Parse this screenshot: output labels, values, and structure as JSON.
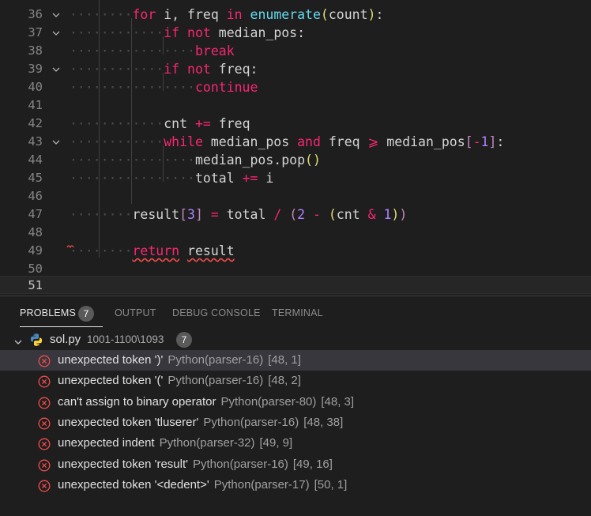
{
  "colors": {
    "editor_bg": "#1e1e1e",
    "keyword": "#f92672",
    "function": "#66d9ef",
    "number": "#ae81ff",
    "error": "#f14c4c",
    "badge_bg": "#5a5a5a",
    "selected_row": "#37373d"
  },
  "editor": {
    "lines": [
      {
        "n": "36"
      },
      {
        "n": "37"
      },
      {
        "n": "38"
      },
      {
        "n": "39"
      },
      {
        "n": "40"
      },
      {
        "n": "41"
      },
      {
        "n": "42"
      },
      {
        "n": "43"
      },
      {
        "n": "44"
      },
      {
        "n": "45"
      },
      {
        "n": "46"
      },
      {
        "n": "47"
      },
      {
        "n": "48"
      },
      {
        "n": "49"
      },
      {
        "n": "50"
      },
      {
        "n": "51"
      }
    ],
    "code": {
      "l36": {
        "indent": "········",
        "for": "for",
        "var": " i, freq ",
        "in": "in",
        "sp": " ",
        "fn": "enumerate",
        "p1": "(",
        "arg": "count",
        "p2": ")",
        "tail": ":"
      },
      "l37": {
        "indent": "············",
        "if": "if",
        "sp": " ",
        "not": "not",
        "rest": " median_pos:"
      },
      "l38": {
        "indent": "················",
        "kw": "break"
      },
      "l39": {
        "indent": "············",
        "if": "if",
        "sp": " ",
        "not": "not",
        "rest": " freq:"
      },
      "l40": {
        "indent": "················",
        "kw": "continue"
      },
      "l42": {
        "indent": "············",
        "a": "cnt ",
        "op": "+=",
        "b": " freq"
      },
      "l43": {
        "indent": "············",
        "while": "while",
        "a": " median_pos ",
        "and": "and",
        "b": " freq ",
        "ge": "⩾",
        "c": " median_pos",
        "br1": "[",
        "minus": "-",
        "one": "1",
        "br2": "]",
        "tail": ":"
      },
      "l44": {
        "indent": "················",
        "a": "median_pos.pop",
        "p": "()"
      },
      "l45": {
        "indent": "················",
        "a": "total ",
        "op": "+=",
        "b": " i"
      },
      "l47": {
        "indent": "········",
        "a": "result",
        "br1": "[",
        "three": "3",
        "br2": "]",
        "eq": " = ",
        "b": "total ",
        "div": "/",
        "sp": " ",
        "p1": "(",
        "two": "2",
        "sp2": " ",
        "minus": "-",
        "sp3": " ",
        "p2": "(",
        "c": "cnt ",
        "amp": "&",
        "sp4": " ",
        "one": "1",
        "p3": ")",
        "p4": ")"
      },
      "l49": {
        "indent": "········",
        "ret": "return",
        "sp": " ",
        "res": "result"
      }
    }
  },
  "panel": {
    "tabs": [
      {
        "label": "PROBLEMS"
      },
      {
        "label": "OUTPUT"
      },
      {
        "label": "DEBUG CONSOLE"
      },
      {
        "label": "TERMINAL"
      }
    ],
    "problems_count": "7",
    "file": {
      "name": "sol.py",
      "path": "1001-1100\\1093",
      "count": "7",
      "icon": "python-icon"
    },
    "errors": [
      {
        "message": "unexpected token ')'",
        "source": "Python(parser-16)",
        "position": "[48, 1]"
      },
      {
        "message": "unexpected token '('",
        "source": "Python(parser-16)",
        "position": "[48, 2]"
      },
      {
        "message": "can't assign to binary operator",
        "source": "Python(parser-80)",
        "position": "[48, 3]"
      },
      {
        "message": "unexpected token 'tluserer'",
        "source": "Python(parser-16)",
        "position": "[48, 38]"
      },
      {
        "message": "unexpected indent",
        "source": "Python(parser-32)",
        "position": "[49, 9]"
      },
      {
        "message": "unexpected token 'result'",
        "source": "Python(parser-16)",
        "position": "[49, 16]"
      },
      {
        "message": "unexpected token '<dedent>'",
        "source": "Python(parser-17)",
        "position": "[50, 1]"
      }
    ]
  }
}
